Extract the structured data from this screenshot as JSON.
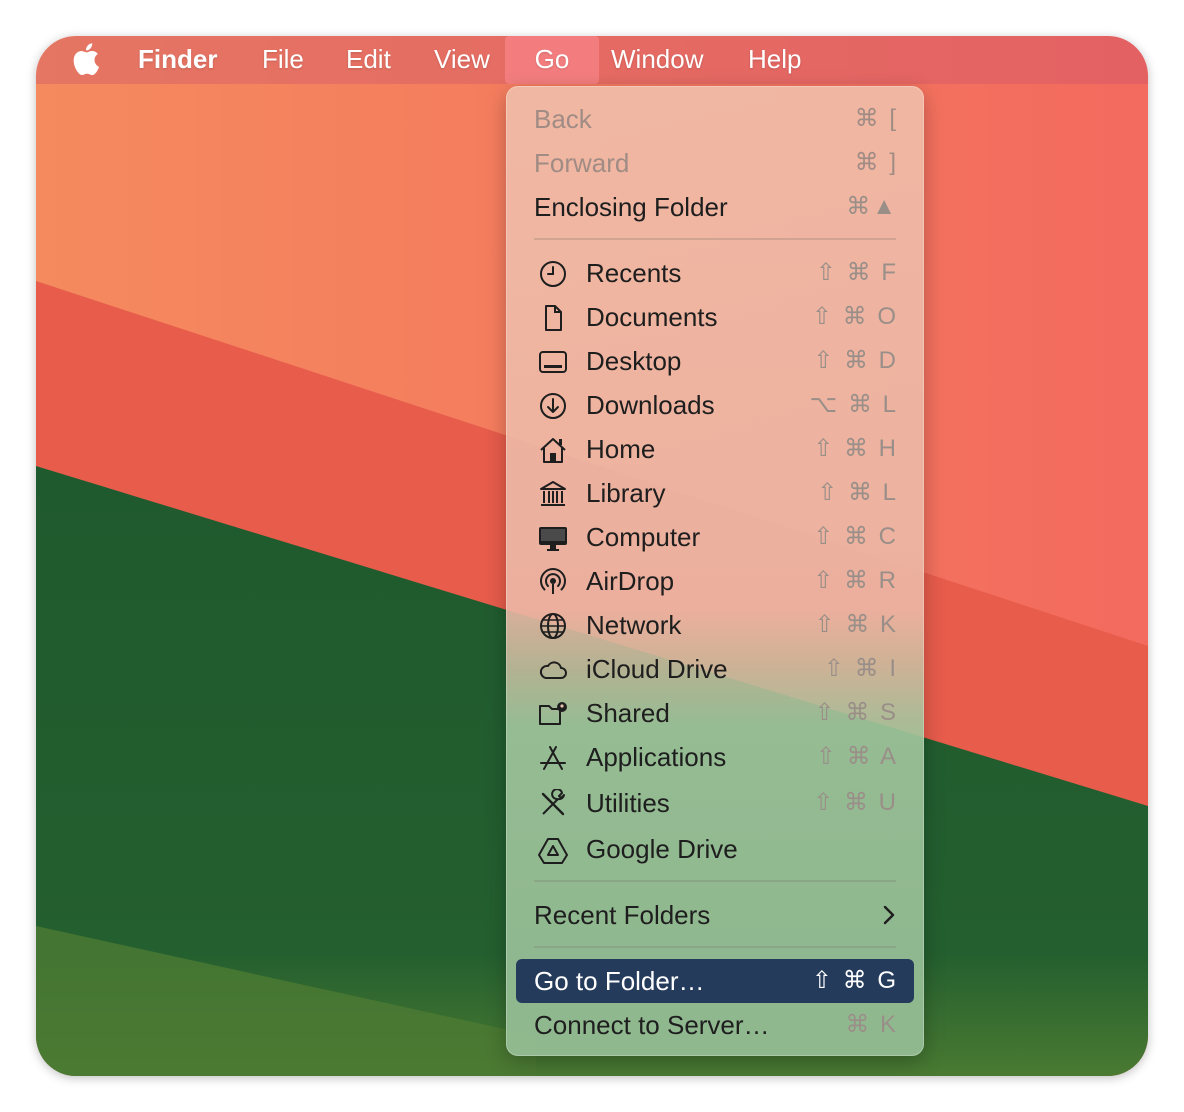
{
  "menubar": {
    "apple_icon": "apple-logo-icon",
    "items": [
      "Finder",
      "File",
      "Edit",
      "View",
      "Go",
      "Window",
      "Help"
    ],
    "active": "Go"
  },
  "go_menu": {
    "back": {
      "label": "Back",
      "shortcut": "⌘ [",
      "enabled": false
    },
    "forward": {
      "label": "Forward",
      "shortcut": "⌘ ]",
      "enabled": false
    },
    "enclosing": {
      "label": "Enclosing Folder",
      "shortcut": "⌘▲",
      "enabled": true
    },
    "places": [
      {
        "label": "Recents",
        "shortcut": "⇧ ⌘ F",
        "icon": "clock-icon"
      },
      {
        "label": "Documents",
        "shortcut": "⇧ ⌘ O",
        "icon": "document-icon"
      },
      {
        "label": "Desktop",
        "shortcut": "⇧ ⌘ D",
        "icon": "desktop-icon"
      },
      {
        "label": "Downloads",
        "shortcut": "⌥ ⌘ L",
        "icon": "download-circle-icon"
      },
      {
        "label": "Home",
        "shortcut": "⇧ ⌘ H",
        "icon": "house-icon"
      },
      {
        "label": "Library",
        "shortcut": "⇧ ⌘ L",
        "icon": "library-building-icon"
      },
      {
        "label": "Computer",
        "shortcut": "⇧ ⌘ C",
        "icon": "computer-display-icon"
      },
      {
        "label": "AirDrop",
        "shortcut": "⇧ ⌘ R",
        "icon": "airdrop-icon"
      },
      {
        "label": "Network",
        "shortcut": "⇧ ⌘ K",
        "icon": "globe-icon"
      },
      {
        "label": "iCloud Drive",
        "shortcut": "⇧ ⌘ I",
        "icon": "cloud-icon"
      },
      {
        "label": "Shared",
        "shortcut": "⇧ ⌘ S",
        "icon": "shared-folder-icon"
      },
      {
        "label": "Applications",
        "shortcut": "⇧ ⌘ A",
        "icon": "app-store-icon"
      },
      {
        "label": "Utilities",
        "shortcut": "⇧ ⌘ U",
        "icon": "tools-icon"
      },
      {
        "label": "Google Drive",
        "shortcut": "",
        "icon": "google-drive-icon"
      }
    ],
    "recent_folders": {
      "label": "Recent Folders",
      "icon": "chevron-right-icon"
    },
    "go_to_folder": {
      "label": "Go to Folder…",
      "shortcut": "⇧ ⌘ G",
      "highlighted": true
    },
    "connect_server": {
      "label": "Connect to Server…",
      "shortcut": "⌘ K"
    }
  },
  "colors": {
    "highlight": "#243b5c",
    "wallpaper_orange": "#f5845c",
    "wallpaper_red": "#e85a4a",
    "wallpaper_green": "#1e5a2e"
  }
}
